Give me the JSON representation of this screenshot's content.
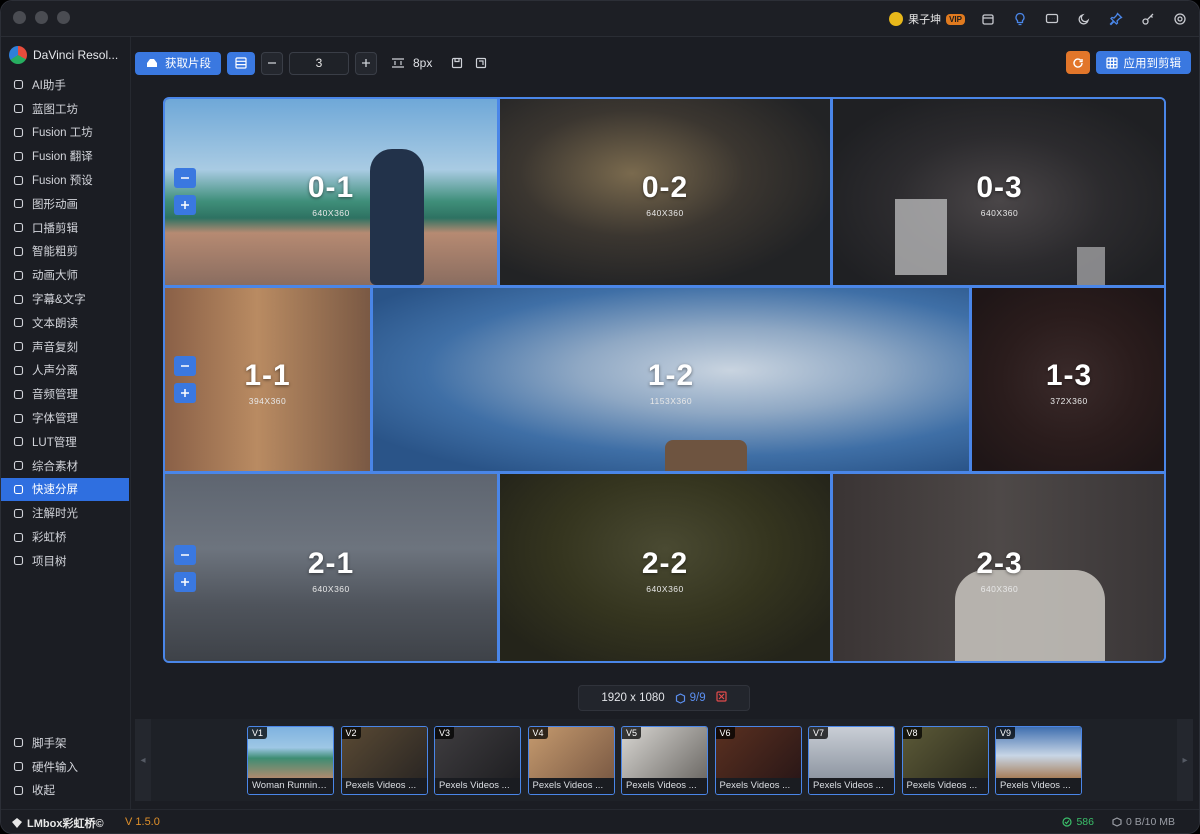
{
  "titlebar": {
    "user_name": "果子坤",
    "vip_badge": "VIP"
  },
  "sidebar": {
    "app_title": "DaVinci Resol...",
    "items": [
      {
        "label": "AI助手",
        "icon": "sparkle-icon"
      },
      {
        "label": "蓝图工坊",
        "icon": "blueprint-icon"
      },
      {
        "label": "Fusion 工坊",
        "icon": "fusion-icon"
      },
      {
        "label": "Fusion 翻译",
        "icon": "translate-icon"
      },
      {
        "label": "Fusion 预设",
        "icon": "preset-icon"
      },
      {
        "label": "图形动画",
        "icon": "graph-animation-icon"
      },
      {
        "label": "口播剪辑",
        "icon": "voice-edit-icon"
      },
      {
        "label": "智能粗剪",
        "icon": "scissors-icon"
      },
      {
        "label": "动画大师",
        "icon": "animation-icon"
      },
      {
        "label": "字幕&文字",
        "icon": "subtitle-icon"
      },
      {
        "label": "文本朗读",
        "icon": "microphone-icon"
      },
      {
        "label": "声音复刻",
        "icon": "voice-clone-icon"
      },
      {
        "label": "人声分离",
        "icon": "person-icon"
      },
      {
        "label": "音频管理",
        "icon": "headphones-icon"
      },
      {
        "label": "字体管理",
        "icon": "font-icon"
      },
      {
        "label": "LUT管理",
        "icon": "lut-icon"
      },
      {
        "label": "综合素材",
        "icon": "assets-icon"
      },
      {
        "label": "快速分屏",
        "icon": "grid-icon",
        "active": true
      },
      {
        "label": "注解时光",
        "icon": "annotation-icon"
      },
      {
        "label": "彩虹桥",
        "icon": "rainbow-icon"
      },
      {
        "label": "项目树",
        "icon": "tree-icon"
      }
    ],
    "bottom_items": [
      {
        "label": "脚手架",
        "icon": "scaffold-icon"
      },
      {
        "label": "硬件输入",
        "icon": "hardware-icon"
      },
      {
        "label": "收起",
        "icon": "chevron-left-icon"
      }
    ]
  },
  "toolbar": {
    "fetch_label": "获取片段",
    "count_value": "3",
    "gap_label": "8px",
    "apply_label": "应用到剪辑"
  },
  "grid": {
    "cells": [
      {
        "label": "0-1",
        "dim": "640X360"
      },
      {
        "label": "0-2",
        "dim": "640X360"
      },
      {
        "label": "0-3",
        "dim": "640X360"
      },
      {
        "label": "1-1",
        "dim": "394X360"
      },
      {
        "label": "1-2",
        "dim": "1153X360"
      },
      {
        "label": "1-3",
        "dim": "372X360"
      },
      {
        "label": "2-1",
        "dim": "640X360"
      },
      {
        "label": "2-2",
        "dim": "640X360"
      },
      {
        "label": "2-3",
        "dim": "640X360"
      }
    ]
  },
  "info": {
    "resolution": "1920 x 1080",
    "count": "9/9"
  },
  "timeline": {
    "clips": [
      {
        "tag": "V1",
        "caption": "Woman Running..."
      },
      {
        "tag": "V2",
        "caption": "Pexels Videos ..."
      },
      {
        "tag": "V3",
        "caption": "Pexels Videos ..."
      },
      {
        "tag": "V4",
        "caption": "Pexels Videos ..."
      },
      {
        "tag": "V5",
        "caption": "Pexels Videos ..."
      },
      {
        "tag": "V6",
        "caption": "Pexels Videos ..."
      },
      {
        "tag": "V7",
        "caption": "Pexels Videos ..."
      },
      {
        "tag": "V8",
        "caption": "Pexels Videos ..."
      },
      {
        "tag": "V9",
        "caption": "Pexels Videos ..."
      }
    ]
  },
  "status": {
    "brand": "LMbox彩虹桥©",
    "version": "V 1.5.0",
    "count": "586",
    "memory": "0 B/10 MB"
  },
  "colors": {
    "accent": "#3a78e0",
    "grid_border": "#4a86e8",
    "orange": "#e2762a",
    "ok_green": "#3bbf6a",
    "version_orange": "#e0902a"
  }
}
